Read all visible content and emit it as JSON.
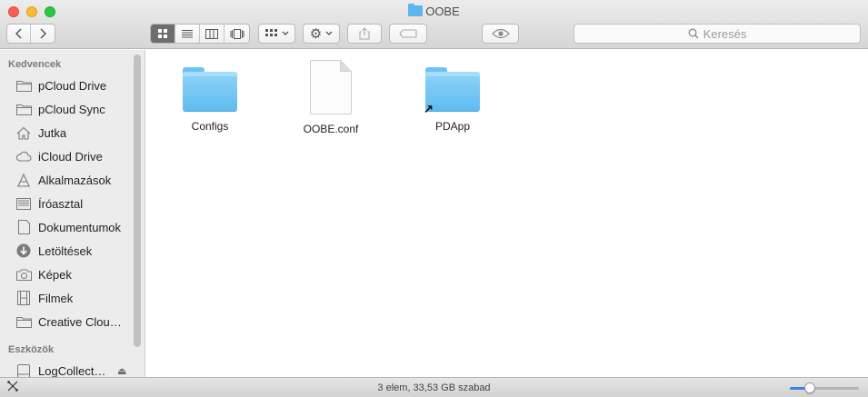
{
  "window": {
    "title": "OOBE"
  },
  "toolbar": {
    "back_icon": "chevron-left-icon",
    "forward_icon": "chevron-right-icon",
    "view_modes": [
      "icon-view",
      "list-view",
      "column-view",
      "cover-flow-view"
    ],
    "active_view": "icon-view",
    "search_placeholder": "Keresés"
  },
  "sidebar": {
    "favorites_header": "Kedvencek",
    "favorites": [
      {
        "label": "pCloud Drive",
        "icon": "folder-icon"
      },
      {
        "label": "pCloud Sync",
        "icon": "folder-icon"
      },
      {
        "label": "Jutka",
        "icon": "home-icon"
      },
      {
        "label": "iCloud Drive",
        "icon": "cloud-icon"
      },
      {
        "label": "Alkalmazások",
        "icon": "applications-icon"
      },
      {
        "label": "Íróasztal",
        "icon": "desktop-icon"
      },
      {
        "label": "Dokumentumok",
        "icon": "documents-icon"
      },
      {
        "label": "Letöltések",
        "icon": "downloads-icon"
      },
      {
        "label": "Képek",
        "icon": "camera-icon"
      },
      {
        "label": "Filmek",
        "icon": "film-icon"
      },
      {
        "label": "Creative Clou…",
        "icon": "folder-icon"
      }
    ],
    "devices_header": "Eszközök",
    "devices": [
      {
        "label": "LogCollect…",
        "icon": "disk-icon"
      }
    ]
  },
  "files": [
    {
      "name": "Configs",
      "kind": "folder"
    },
    {
      "name": "OOBE.conf",
      "kind": "document"
    },
    {
      "name": "PDApp",
      "kind": "folder-alias"
    }
  ],
  "statusbar": {
    "text": "3 elem, 33,53 GB szabad",
    "icon_zoom_level": 0.25
  },
  "colors": {
    "folder_blue": "#5fbcef",
    "close_red": "#fc5f57",
    "minimize_yellow": "#fdbc2e",
    "zoom_green": "#28c840"
  }
}
